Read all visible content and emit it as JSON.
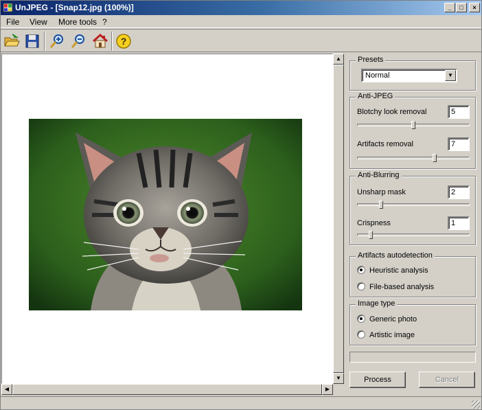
{
  "window": {
    "title": "UnJPEG - [Snap12.jpg (100%)]",
    "minimize_glyph": "_",
    "maximize_glyph": "□",
    "close_glyph": "×"
  },
  "menu": [
    {
      "label": "File"
    },
    {
      "label": "View"
    },
    {
      "label": "More tools"
    },
    {
      "label": "?"
    }
  ],
  "toolbar": [
    {
      "icon": "open-folder-icon"
    },
    {
      "icon": "save-disk-icon"
    },
    {
      "icon": "zoom-in-icon"
    },
    {
      "icon": "zoom-out-icon"
    },
    {
      "icon": "home-icon"
    },
    {
      "icon": "help-icon"
    }
  ],
  "image": {
    "subject": "kitten photo"
  },
  "panel": {
    "presets": {
      "legend": "Presets",
      "selected": "Normal"
    },
    "anti_jpeg": {
      "legend": "Anti-JPEG",
      "blotchy_label": "Blotchy look removal",
      "blotchy_value": "5",
      "blotchy_level": 0.5,
      "artifacts_label": "Artifacts removal",
      "artifacts_value": "7",
      "artifacts_level": 0.7
    },
    "anti_blur": {
      "legend": "Anti-Blurring",
      "unsharp_label": "Unsharp mask",
      "unsharp_value": "2",
      "unsharp_level": 0.2,
      "crisp_label": "Crispness",
      "crisp_value": "1",
      "crisp_level": 0.1
    },
    "autodetect": {
      "legend": "Artifacts autodetection",
      "heuristic": "Heuristic analysis",
      "file_based": "File-based analysis",
      "selected": "heuristic"
    },
    "image_type": {
      "legend": "Image type",
      "generic": "Generic photo",
      "artistic": "Artistic image",
      "selected": "generic"
    },
    "process_label": "Process",
    "cancel_label": "Cancel"
  },
  "colors": {
    "titlebar_start": "#0a246a",
    "titlebar_end": "#a6caf0",
    "face": "#d4d0c8"
  }
}
